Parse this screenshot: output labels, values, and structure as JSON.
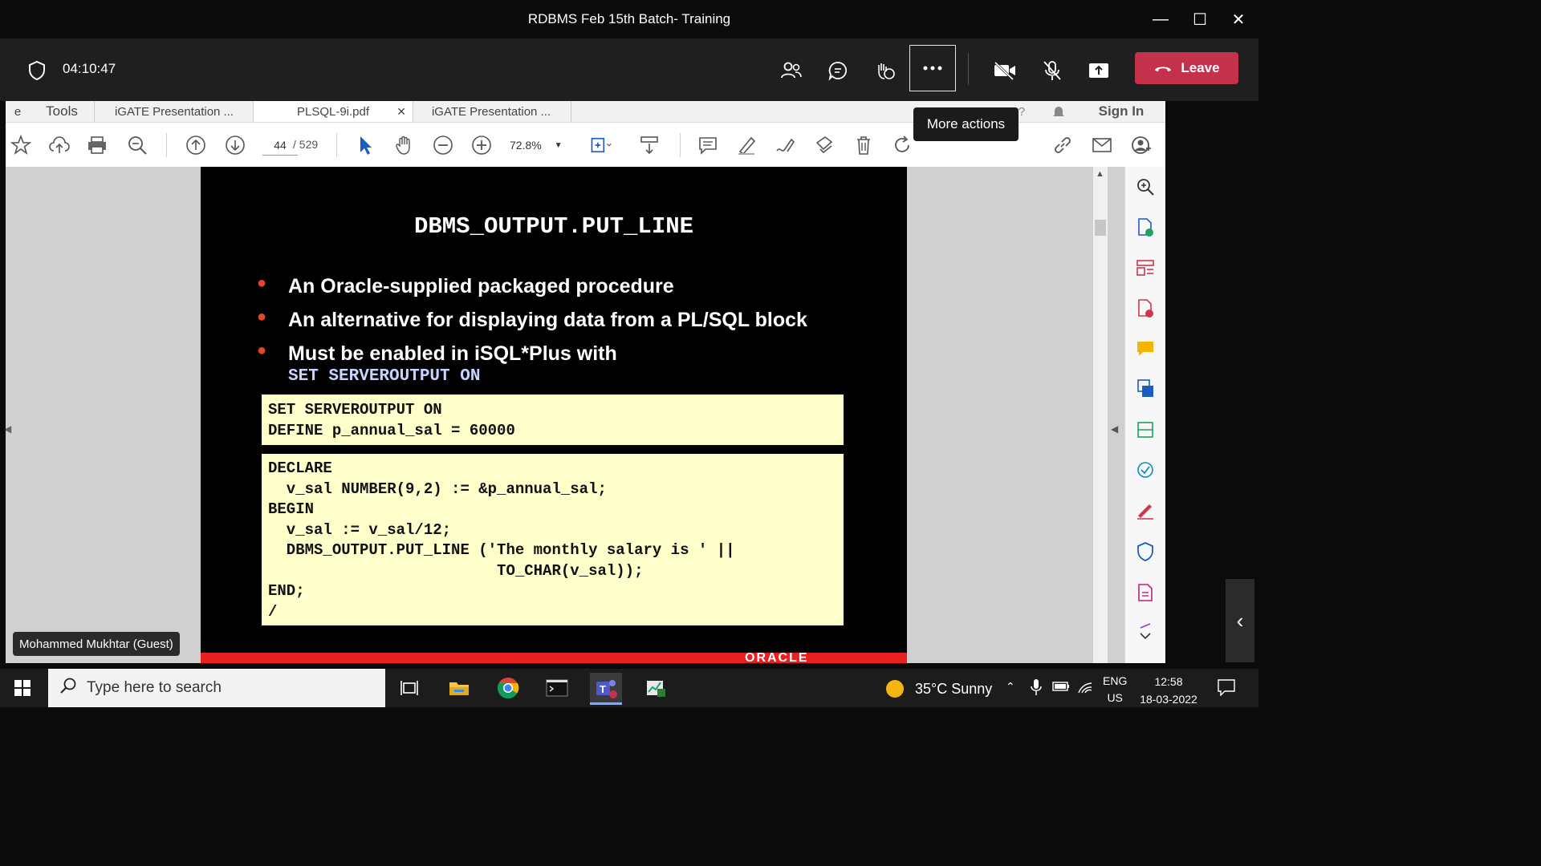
{
  "window": {
    "title": "RDBMS Feb 15th Batch- Training"
  },
  "meeting": {
    "timer": "04:10:47",
    "leave_label": "Leave",
    "tooltip": "More actions",
    "participant_name": "Mohammed Mukhtar (Guest)"
  },
  "reader": {
    "tabs": [
      {
        "label": "e"
      },
      {
        "label": "Tools"
      },
      {
        "label": "iGATE Presentation ..."
      },
      {
        "label": "PLSQL-9i.pdf"
      },
      {
        "label": "iGATE Presentation ..."
      }
    ],
    "sign_in": "Sign In",
    "page_current": "44",
    "page_total": "/ 529",
    "zoom": "72.8%"
  },
  "slide": {
    "title": "DBMS_OUTPUT.PUT_LINE",
    "bullets": [
      "An Oracle-supplied packaged procedure",
      "An alternative for displaying data from a PL/SQL block",
      "Must be enabled in iSQL*Plus with"
    ],
    "bullet3_code": "SET SERVEROUTPUT ON",
    "code1": "SET SERVEROUTPUT ON\nDEFINE p_annual_sal = 60000",
    "code2": "DECLARE\n  v_sal NUMBER(9,2) := &p_annual_sal;\nBEGIN\n  v_sal := v_sal/12;\n  DBMS_OUTPUT.PUT_LINE ('The monthly salary is ' ||\n                         TO_CHAR(v_sal));\nEND;\n/",
    "footer_logo": "ORACLE"
  },
  "taskbar": {
    "search_placeholder": "Type here to search",
    "weather": "35°C  Sunny",
    "lang_top": "ENG",
    "lang_bottom": "US",
    "time": "12:58",
    "date": "18-03-2022"
  }
}
